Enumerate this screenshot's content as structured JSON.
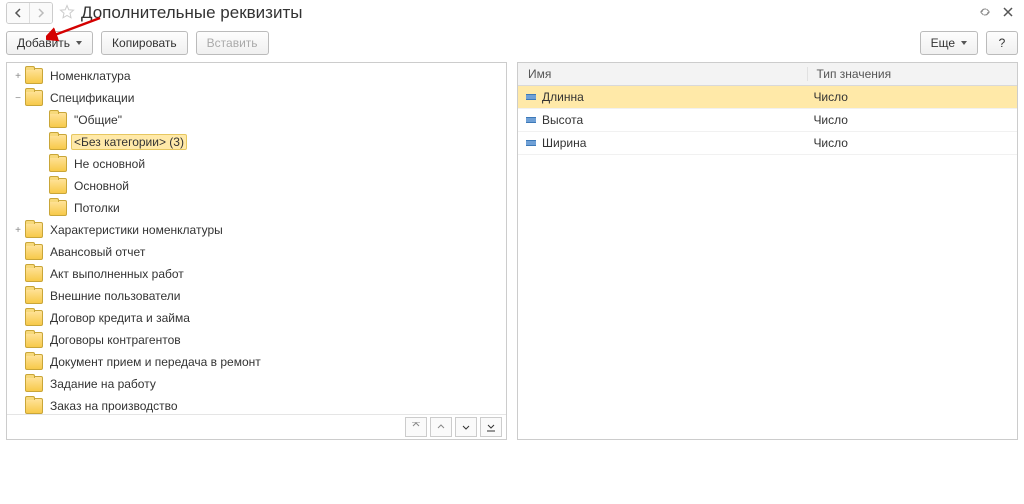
{
  "header": {
    "title": "Дополнительные реквизиты"
  },
  "toolbar": {
    "add": "Добавить",
    "copy": "Копировать",
    "paste": "Вставить",
    "more": "Еще",
    "help": "?"
  },
  "tree": [
    {
      "level": 0,
      "expander": "+",
      "label": "Номенклатура"
    },
    {
      "level": 0,
      "expander": "−",
      "label": "Спецификации"
    },
    {
      "level": 1,
      "expander": "",
      "label": "\"Общие\""
    },
    {
      "level": 1,
      "expander": "",
      "label": "<Без категории> (3)",
      "selected": true
    },
    {
      "level": 1,
      "expander": "",
      "label": "Не основной"
    },
    {
      "level": 1,
      "expander": "",
      "label": "Основной"
    },
    {
      "level": 1,
      "expander": "",
      "label": "Потолки"
    },
    {
      "level": 0,
      "expander": "+",
      "label": "Характеристики номенклатуры"
    },
    {
      "level": 0,
      "expander": "",
      "label": "Авансовый отчет"
    },
    {
      "level": 0,
      "expander": "",
      "label": "Акт выполненных работ"
    },
    {
      "level": 0,
      "expander": "",
      "label": "Внешние пользователи"
    },
    {
      "level": 0,
      "expander": "",
      "label": "Договор кредита и займа"
    },
    {
      "level": 0,
      "expander": "",
      "label": "Договоры контрагентов"
    },
    {
      "level": 0,
      "expander": "",
      "label": "Документ прием и передача в ремонт"
    },
    {
      "level": 0,
      "expander": "",
      "label": "Задание на работу"
    },
    {
      "level": 0,
      "expander": "",
      "label": "Заказ на производство"
    }
  ],
  "table": {
    "columns": {
      "name": "Имя",
      "type": "Тип значения"
    },
    "rows": [
      {
        "name": "Длинна",
        "type": "Число",
        "selected": true
      },
      {
        "name": "Высота",
        "type": "Число"
      },
      {
        "name": "Ширина",
        "type": "Число"
      }
    ]
  }
}
